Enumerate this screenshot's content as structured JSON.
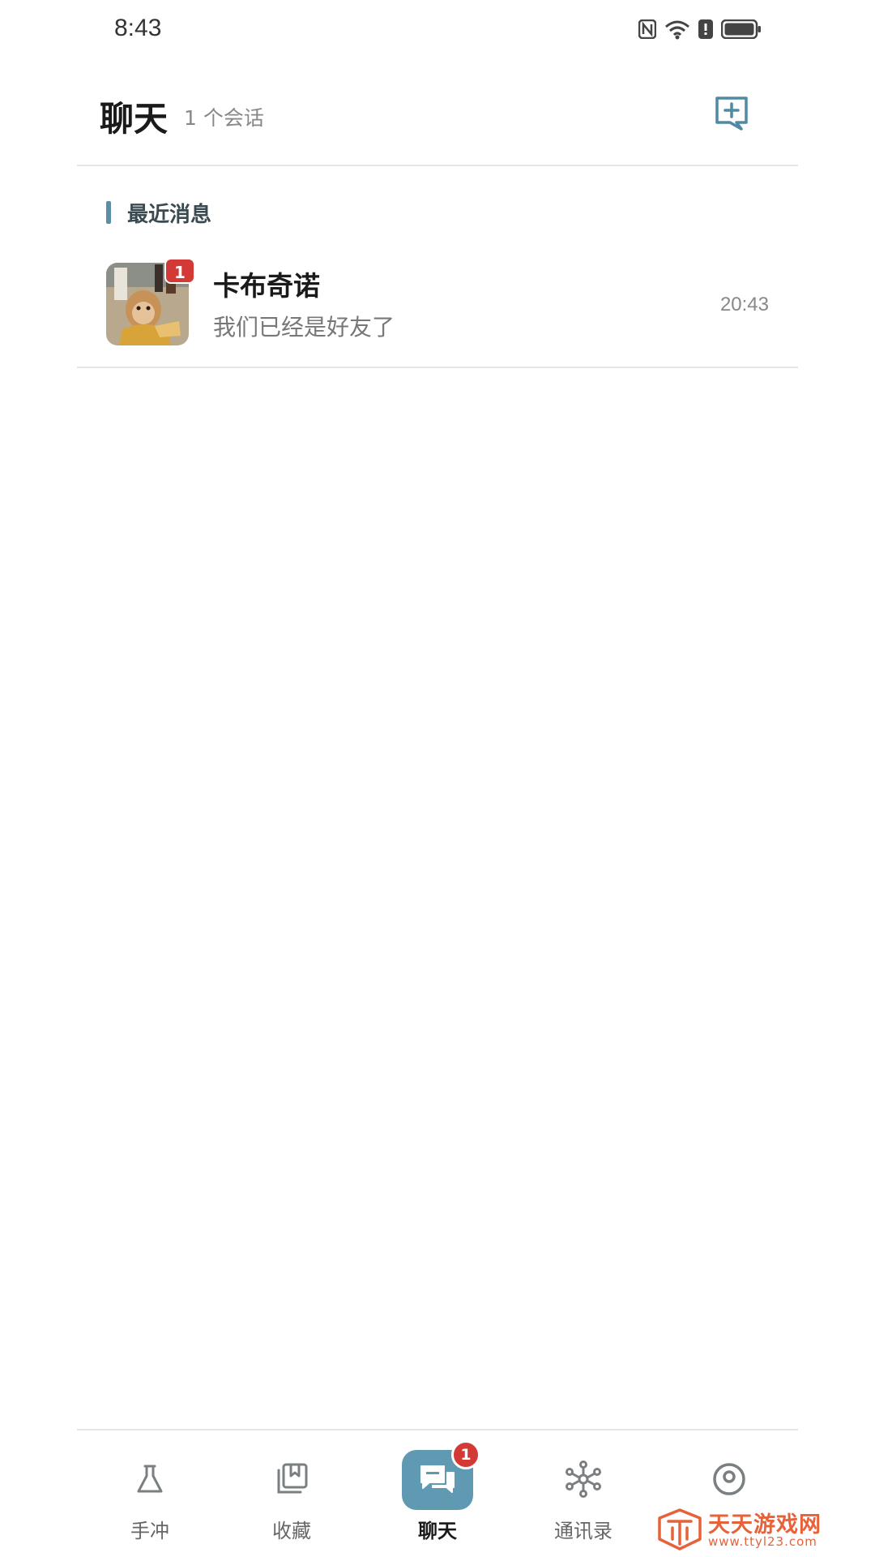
{
  "status_bar": {
    "time": "8:43",
    "icons": [
      "nfc-icon",
      "wifi-6-icon",
      "alert-icon",
      "battery-icon"
    ]
  },
  "header": {
    "title": "聊天",
    "subtitle": "1 个会话",
    "action_icon": "new-chat-icon"
  },
  "section": {
    "title": "最近消息"
  },
  "conversations": [
    {
      "name": "卡布奇诺",
      "preview": "我们已经是好友了",
      "time": "20:43",
      "unread": "1"
    }
  ],
  "bottom_nav": {
    "items": [
      {
        "label": "手冲",
        "icon": "flask-icon"
      },
      {
        "label": "收藏",
        "icon": "collection-icon"
      },
      {
        "label": "聊天",
        "icon": "chat-bubbles-icon",
        "badge": "1",
        "active": true
      },
      {
        "label": "通讯录",
        "icon": "network-icon"
      },
      {
        "label": "",
        "icon": "profile-icon"
      }
    ]
  },
  "watermark": {
    "text": "天天游戏网",
    "url": "www.ttyl23.com"
  },
  "colors": {
    "accent": "#5f9ab2",
    "badge": "#d33a36",
    "watermark": "#e6623a"
  }
}
